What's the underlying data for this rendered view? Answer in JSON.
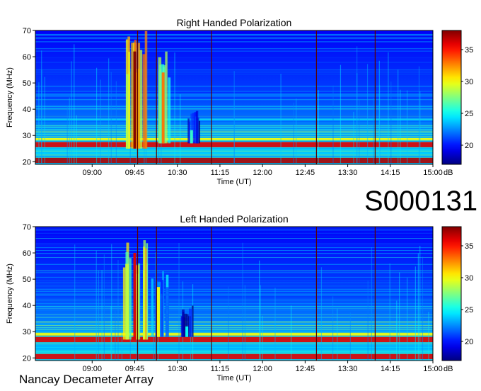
{
  "identifier": "S000131",
  "footer": "Nancay Decameter Array",
  "chart_data": [
    {
      "type": "heatmap",
      "title": "Right Handed Polarization",
      "xlabel": "Time (UT)",
      "ylabel": "Frequency (MHz)",
      "xticks": [
        "09:00",
        "09:45",
        "10:30",
        "11:15",
        "12:00",
        "12:45",
        "13:30",
        "14:15",
        "15:00"
      ],
      "xlim_minutes": [
        480,
        900
      ],
      "yticks": [
        20,
        30,
        40,
        50,
        60,
        70
      ],
      "ylim": [
        19,
        70
      ],
      "colorbar": {
        "label": "dB",
        "ticks": [
          20,
          25,
          30,
          35
        ],
        "range": [
          17,
          38
        ]
      },
      "markers_time": [
        "09:48",
        "10:08",
        "11:06",
        "12:57",
        "13:59"
      ],
      "bursts": [
        {
          "time": "09:45",
          "fmin": 25,
          "fmax": 70,
          "intensity": 38
        },
        {
          "time": "10:15",
          "fmin": 27,
          "fmax": 62,
          "intensity": 33
        },
        {
          "time": "10:45",
          "fmin": 27,
          "fmax": 40,
          "intensity": 26
        }
      ],
      "bands_mhz": [
        {
          "fmin": 19.5,
          "fmax": 21.5,
          "level": 37
        },
        {
          "fmin": 25.5,
          "fmax": 27.5,
          "level": 36
        },
        {
          "fmin": 28.2,
          "fmax": 29.0,
          "level": 30
        }
      ]
    },
    {
      "type": "heatmap",
      "title": "Left Handed Polarization",
      "xlabel": "Time (UT)",
      "ylabel": "Frequency (MHz)",
      "xticks": [
        "09:00",
        "09:45",
        "10:30",
        "11:15",
        "12:00",
        "12:45",
        "13:30",
        "14:15",
        "15:00"
      ],
      "xlim_minutes": [
        480,
        900
      ],
      "yticks": [
        20,
        30,
        40,
        50,
        60,
        70
      ],
      "ylim": [
        19,
        70
      ],
      "colorbar": {
        "label": "dB",
        "ticks": [
          20,
          25,
          30,
          35
        ],
        "range": [
          17,
          38
        ]
      },
      "markers_time": [
        "09:48",
        "10:08",
        "11:06",
        "12:57",
        "13:59"
      ],
      "bursts": [
        {
          "time": "09:45",
          "fmin": 27,
          "fmax": 68,
          "intensity": 36
        },
        {
          "time": "10:10",
          "fmin": 28,
          "fmax": 55,
          "intensity": 30
        },
        {
          "time": "10:40",
          "fmin": 28,
          "fmax": 40,
          "intensity": 25
        }
      ],
      "bands_mhz": [
        {
          "fmin": 19.5,
          "fmax": 21.5,
          "level": 36
        },
        {
          "fmin": 26.0,
          "fmax": 28.0,
          "level": 36
        },
        {
          "fmin": 28.5,
          "fmax": 29.5,
          "level": 30
        }
      ]
    }
  ]
}
